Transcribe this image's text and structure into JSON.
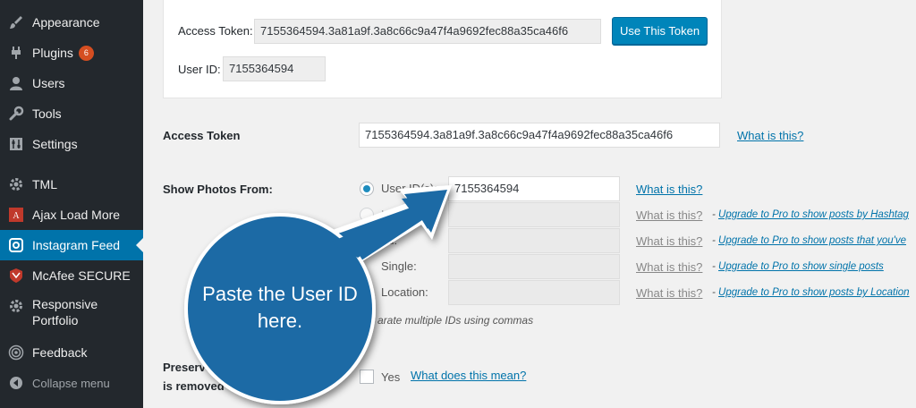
{
  "sidebar": {
    "items": [
      {
        "label": "Appearance",
        "icon": "paintbrush-icon"
      },
      {
        "label": "Plugins",
        "icon": "plug-icon",
        "badge": "6"
      },
      {
        "label": "Users",
        "icon": "user-icon"
      },
      {
        "label": "Tools",
        "icon": "wrench-icon"
      },
      {
        "label": "Settings",
        "icon": "settings-icon"
      },
      {
        "label": "TML",
        "icon": "gear-icon"
      },
      {
        "label": "Ajax Load More",
        "icon": "ajax-load-more-icon"
      },
      {
        "label": "Instagram Feed",
        "icon": "instagram-icon",
        "active": true
      },
      {
        "label": "McAfee SECURE",
        "icon": "shield-icon"
      },
      {
        "label": "Responsive Portfolio",
        "icon": "gear-icon"
      },
      {
        "label": "Feedback",
        "icon": "feedback-icon"
      }
    ],
    "collapse_label": "Collapse menu",
    "active_color": "#0073aa"
  },
  "token_box": {
    "access_token_label": "Access Token:",
    "access_token_value": "7155364594.3a81a9f.3a8c66c9a47f4a9692fec88a35ca46f6",
    "use_button": "Use This Token",
    "user_id_label": "User ID:",
    "user_id_value": "7155364594"
  },
  "form": {
    "access_token": {
      "label": "Access Token",
      "value": "7155364594.3a81a9f.3a8c66c9a47f4a9692fec88a35ca46f6",
      "help": "What is this?"
    },
    "show_photos": {
      "label": "Show Photos From:",
      "options": [
        {
          "label": "User ID(s):",
          "value": "7155364594",
          "help": "What is this?",
          "selected": true
        },
        {
          "label": "Ha",
          "value": "",
          "help": "What is this?",
          "upgrade": "Upgrade to Pro to show posts by Hashtag"
        },
        {
          "label": "ed:",
          "value": "",
          "help": "What is this?",
          "upgrade": "Upgrade to Pro to show posts that you've"
        },
        {
          "label": "Single:",
          "value": "",
          "help": "What is this?",
          "upgrade": "Upgrade to Pro to show single posts"
        },
        {
          "label": "Location:",
          "value": "",
          "help": "What is this?",
          "upgrade": "Upgrade to Pro to show posts by Location"
        }
      ],
      "hint": "arate multiple IDs using commas"
    },
    "preserve": {
      "label_line1": "Preserve",
      "label_line2": "is removed",
      "checkbox_label": "Yes",
      "help": "What does this mean?"
    }
  },
  "callout": {
    "text": "Paste the User ID here.",
    "color": "#1f6ba5"
  }
}
